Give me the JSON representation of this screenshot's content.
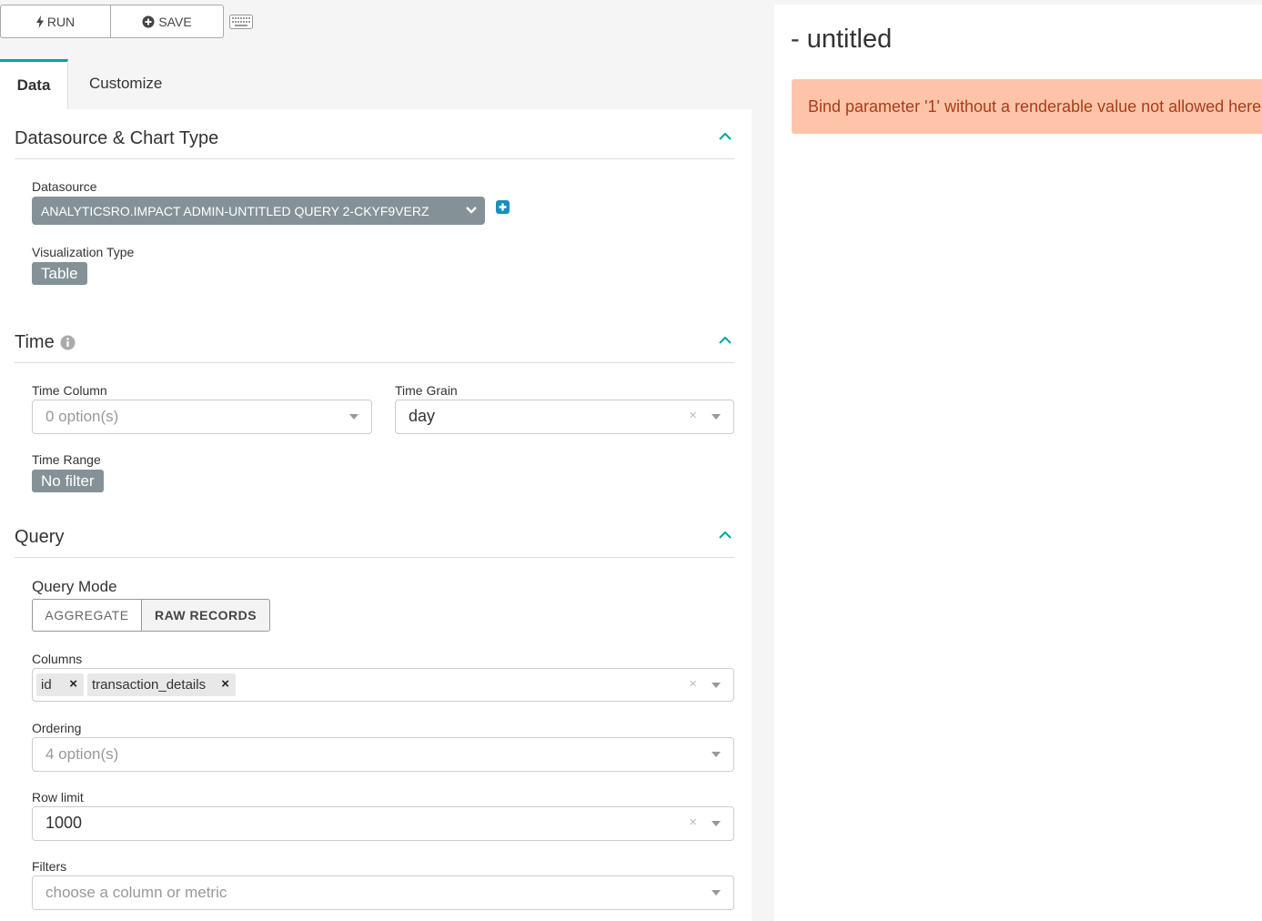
{
  "toolbar": {
    "run_label": "RUN",
    "save_label": "SAVE",
    "run_icon": "bolt-icon",
    "save_icon": "plus-circle-icon",
    "keyboard_icon": "keyboard-icon"
  },
  "tabs": [
    {
      "label": "Data",
      "active": true
    },
    {
      "label": "Customize",
      "active": false
    }
  ],
  "sections": {
    "datasource": {
      "title": "Datasource & Chart Type",
      "datasource_label": "Datasource",
      "datasource_value": "ANALYTICSRO.IMPACT ADMIN-UNTITLED QUERY 2-CKYF9VERZ",
      "viz_label": "Visualization Type",
      "viz_value": "Table"
    },
    "time": {
      "title": "Time",
      "time_column_label": "Time Column",
      "time_column_placeholder": "0 option(s)",
      "time_grain_label": "Time Grain",
      "time_grain_value": "day",
      "time_range_label": "Time Range",
      "time_range_value": "No filter"
    },
    "query": {
      "title": "Query",
      "mode_label": "Query Mode",
      "mode_options": [
        "AGGREGATE",
        "RAW RECORDS"
      ],
      "mode_selected": "RAW RECORDS",
      "columns_label": "Columns",
      "columns": [
        "id",
        "transaction_details"
      ],
      "ordering_label": "Ordering",
      "ordering_placeholder": "4 option(s)",
      "row_limit_label": "Row limit",
      "row_limit_value": "1000",
      "filters_label": "Filters",
      "filters_placeholder": "choose a column or metric"
    }
  },
  "chart": {
    "title": "- untitled",
    "error": "Bind parameter '1' without a renderable value not allowed here."
  },
  "colors": {
    "accent": "#00a699",
    "pill": "#849297",
    "alert_bg": "#fec4a9",
    "alert_text": "#a83d1b"
  }
}
